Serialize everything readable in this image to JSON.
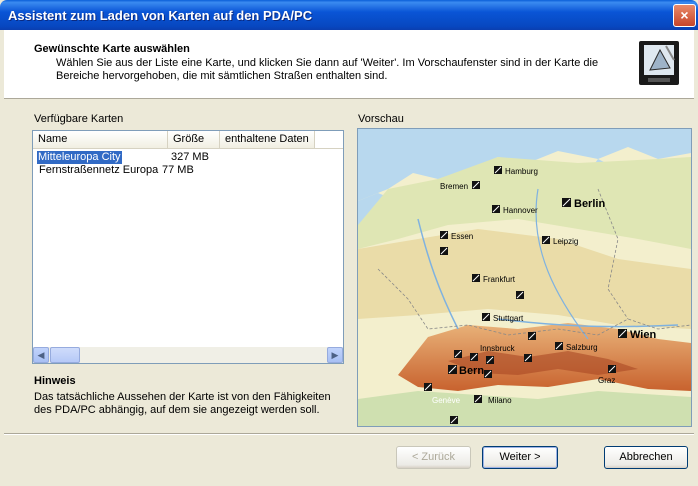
{
  "window": {
    "title": "Assistent zum Laden von Karten auf den PDA/PC",
    "close_label": "×"
  },
  "header": {
    "title": "Gewünschte Karte auswählen",
    "description": "Wählen Sie aus der Liste eine Karte, und klicken Sie dann auf 'Weiter'. Im Vorschaufenster sind in der Karte die Bereiche hervorgehoben, die mit sämtlichen Straßen enthalten sind.",
    "icon": "pda-icon"
  },
  "maps_list": {
    "label": "Verfügbare Karten",
    "columns": [
      "Name",
      "Größe",
      "enthaltene Daten"
    ],
    "rows": [
      {
        "name": "Mitteleuropa City",
        "size": "327 MB",
        "data": ""
      },
      {
        "name": "Fernstraßennetz Europa",
        "size": "77 MB",
        "data": ""
      }
    ],
    "selected_index": 0
  },
  "hint": {
    "title": "Hinweis",
    "text": "Das tatsächliche Aussehen der Karte ist von den Fähigkeiten des PDA/PC abhängig, auf dem sie angezeigt werden soll."
  },
  "preview": {
    "label": "Vorschau",
    "cities": [
      "Hamburg",
      "Bremen",
      "Berlin",
      "Hannover",
      "Essen",
      "Leipzig",
      "Frankfurt",
      "Stuttgart",
      "Innsbruck",
      "Salzburg",
      "Wien",
      "Bern",
      "Graz",
      "Genève",
      "Milano"
    ]
  },
  "buttons": {
    "back": "< Zurück",
    "next": "Weiter >",
    "cancel": "Abbrechen"
  }
}
